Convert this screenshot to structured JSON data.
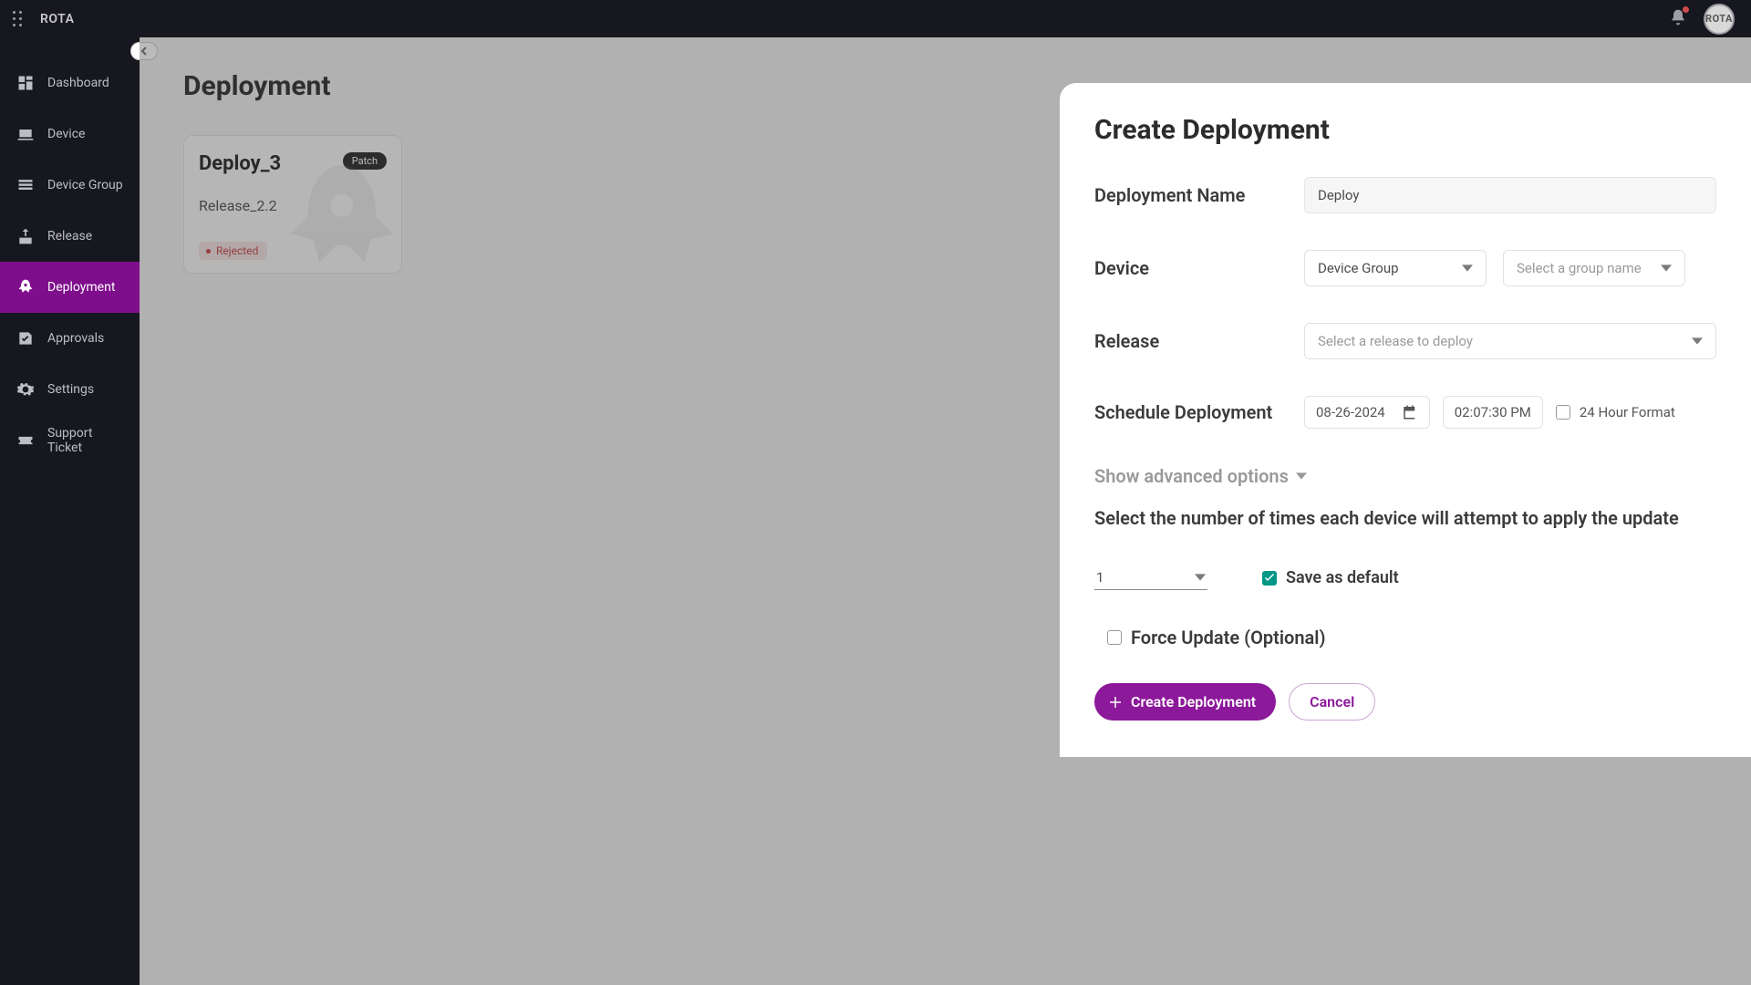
{
  "brand": "ROTA",
  "avatar_text": "ROTA",
  "sidebar": {
    "items": [
      {
        "label": "Dashboard"
      },
      {
        "label": "Device"
      },
      {
        "label": "Device Group"
      },
      {
        "label": "Release"
      },
      {
        "label": "Deployment"
      },
      {
        "label": "Approvals"
      },
      {
        "label": "Settings"
      },
      {
        "label": "Support Ticket"
      }
    ]
  },
  "page": {
    "title": "Deployment"
  },
  "card": {
    "title": "Deploy_3",
    "badge": "Patch",
    "release": "Release_2.2",
    "status": "Rejected"
  },
  "panel": {
    "heading": "Create Deployment",
    "labels": {
      "name": "Deployment Name",
      "device": "Device",
      "release": "Release",
      "schedule": "Schedule Deployment",
      "advanced": "Show advanced options",
      "attempts_text": "Select the number of times each device will attempt to apply the update",
      "save_default": "Save as default",
      "force_update": "Force Update (Optional)",
      "hour24": "24 Hour Format"
    },
    "values": {
      "name": "Deploy",
      "device_type": "Device Group",
      "group_placeholder": "Select a group name",
      "release_placeholder": "Select a release to deploy",
      "date": "08-26-2024",
      "time": "02:07:30 PM",
      "attempts": "1"
    },
    "buttons": {
      "create": "Create Deployment",
      "cancel": "Cancel"
    }
  }
}
